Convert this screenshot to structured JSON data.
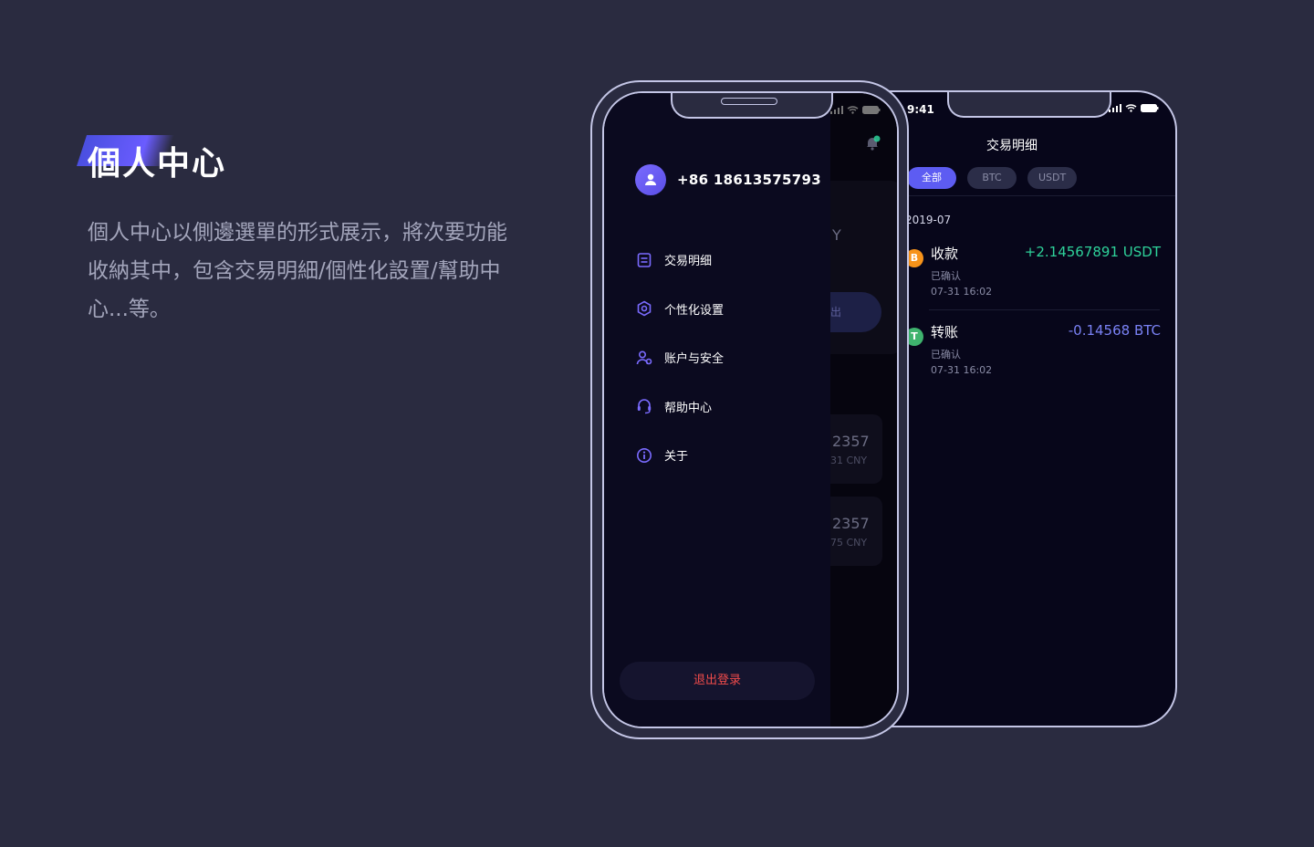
{
  "hero": {
    "title": "個人中心",
    "description": "個人中心以側邊選單的形式展示，將次要功能收納其中，包含交易明細/個性化設置/幫助中心...等。"
  },
  "back_screen": {
    "time": "9:41",
    "title": "交易明细",
    "filters": [
      "全部",
      "BTC",
      "USDT"
    ],
    "month": "2019-07",
    "transactions": [
      {
        "coin": "B",
        "coin_color": "#f7931a",
        "name": "收款",
        "amount": "+2.14567891 USDT",
        "amount_color": "#2ed29a",
        "status": "已确认",
        "time": "07-31 16:02"
      },
      {
        "coin": "T",
        "coin_color": "#3fb36e",
        "name": "转账",
        "amount": "-0.14568 BTC",
        "amount_color": "#7a82f5",
        "status": "已确认",
        "time": "07-31 16:02"
      }
    ]
  },
  "front_screen": {
    "underlay": {
      "partial_letter": "Y",
      "partial_button": "出",
      "card1_value": "2357",
      "card1_sub": "31 CNY",
      "card2_value": "2357",
      "card2_sub": "75 CNY"
    },
    "drawer": {
      "phone": "+86 18613575793",
      "menu": [
        {
          "label": "交易明细",
          "icon": "document-icon"
        },
        {
          "label": "个性化设置",
          "icon": "hexagon-settings-icon"
        },
        {
          "label": "账户与安全",
          "icon": "user-shield-icon"
        },
        {
          "label": "帮助中心",
          "icon": "headset-icon"
        },
        {
          "label": "关于",
          "icon": "info-icon"
        }
      ],
      "logout": "退出登录"
    },
    "accent": "#6a5cff",
    "logout_color": "#f04b4b"
  }
}
